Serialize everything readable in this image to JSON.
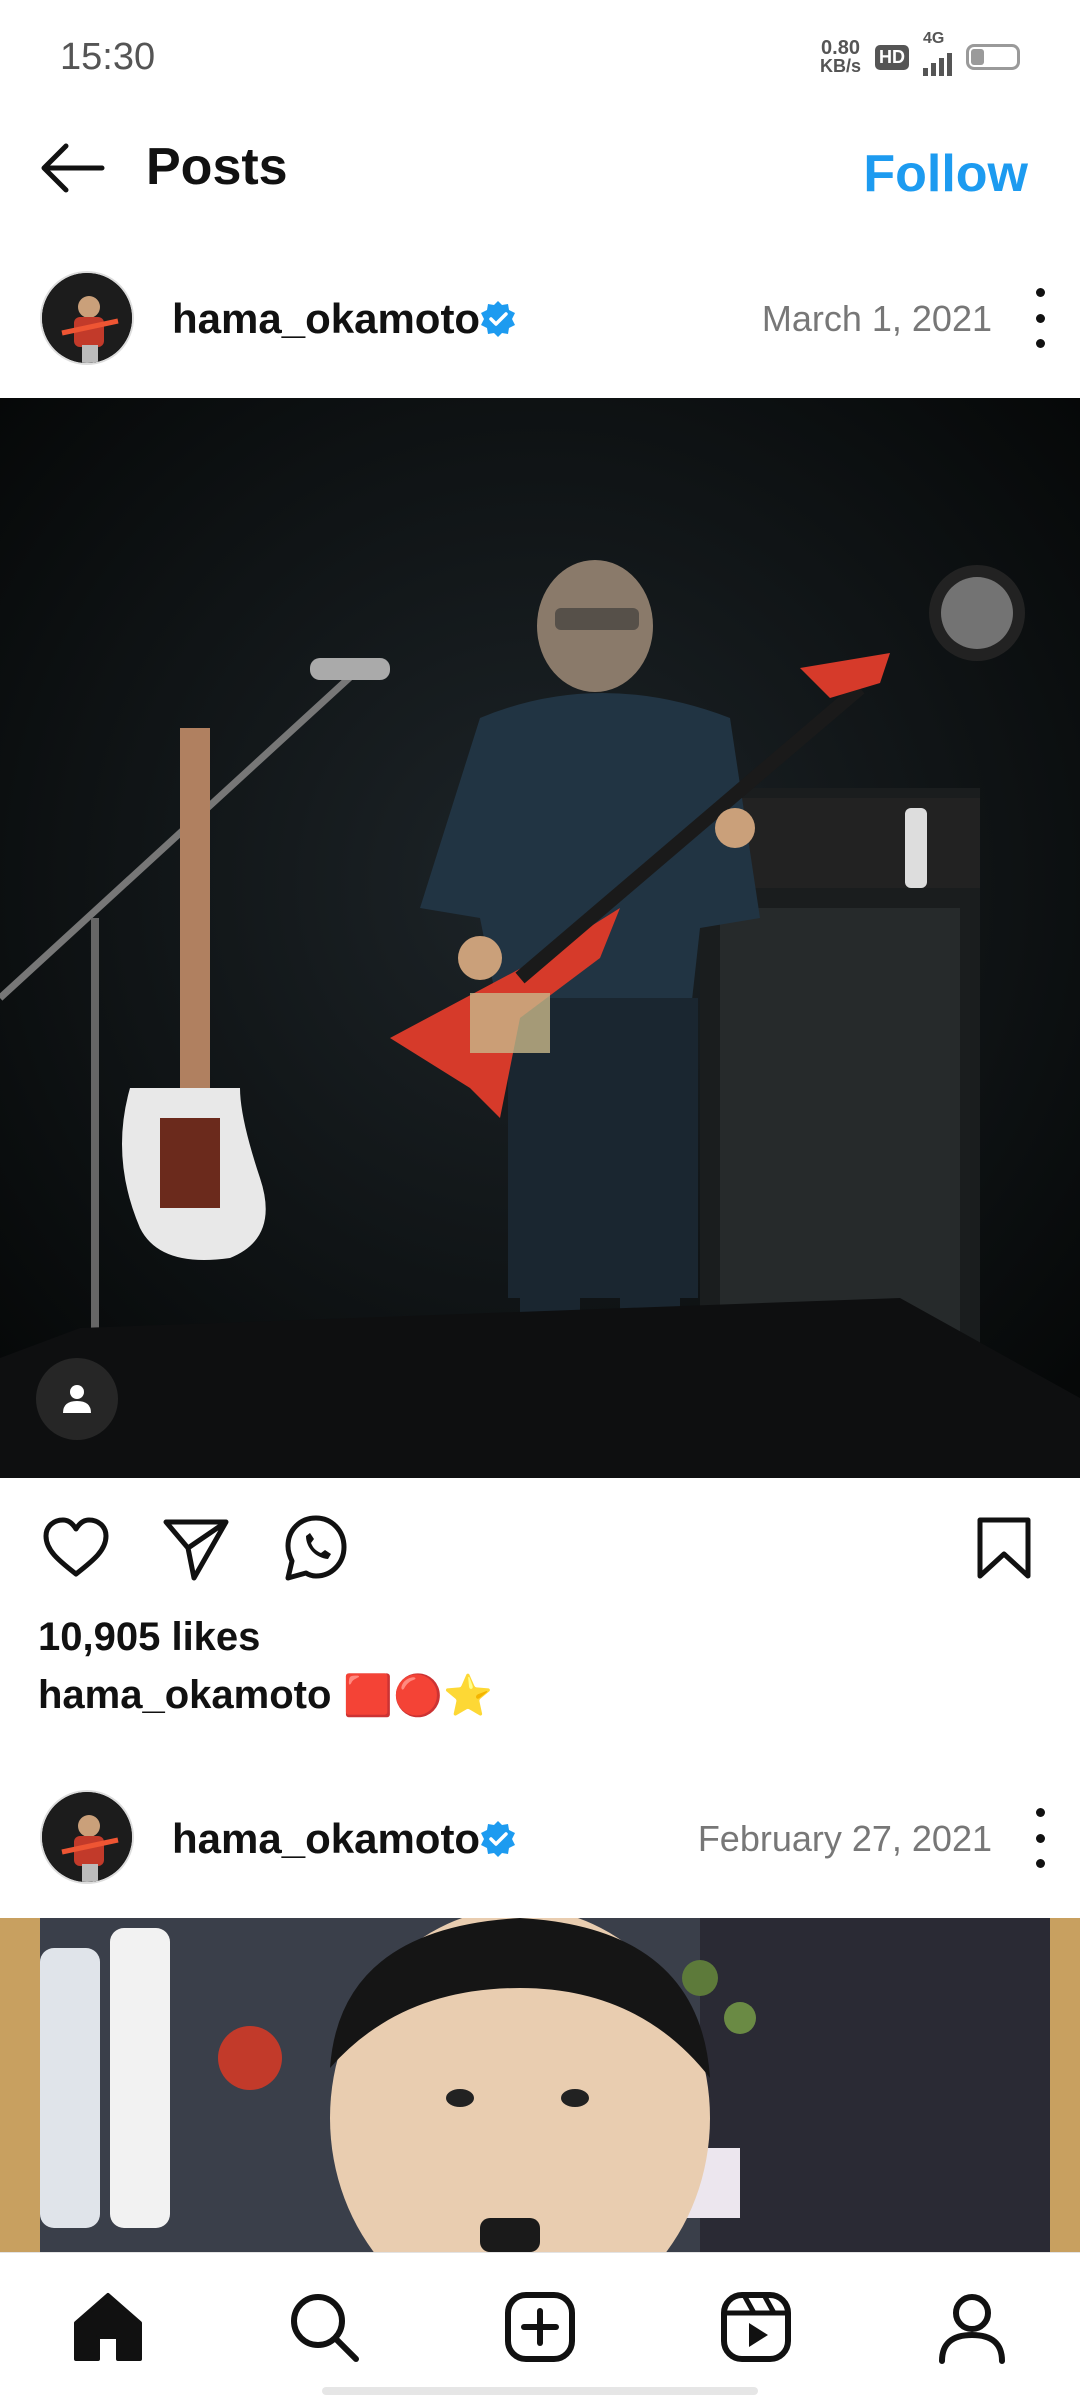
{
  "status_bar": {
    "time": "15:30",
    "net_speed_value": "0.80",
    "net_speed_unit": "KB/s",
    "hd": "HD",
    "network": "4G",
    "battery_level": 0.3
  },
  "header": {
    "title": "Posts",
    "follow_label": "Follow",
    "back_icon": "arrow-left-icon"
  },
  "posts": [
    {
      "username": "hama_okamoto",
      "verified": true,
      "date": "March 1, 2021",
      "likes": "10,905 likes",
      "caption_user": "hama_okamoto",
      "caption_emoji": "🟥🔴⭐"
    },
    {
      "username": "hama_okamoto",
      "verified": true,
      "date": "February 27, 2021"
    }
  ],
  "nav": {
    "items": [
      "home-icon",
      "search-icon",
      "create-icon",
      "reels-icon",
      "profile-icon"
    ]
  },
  "colors": {
    "accent": "#1d9bf0",
    "text": "#111111",
    "muted": "#777777"
  }
}
